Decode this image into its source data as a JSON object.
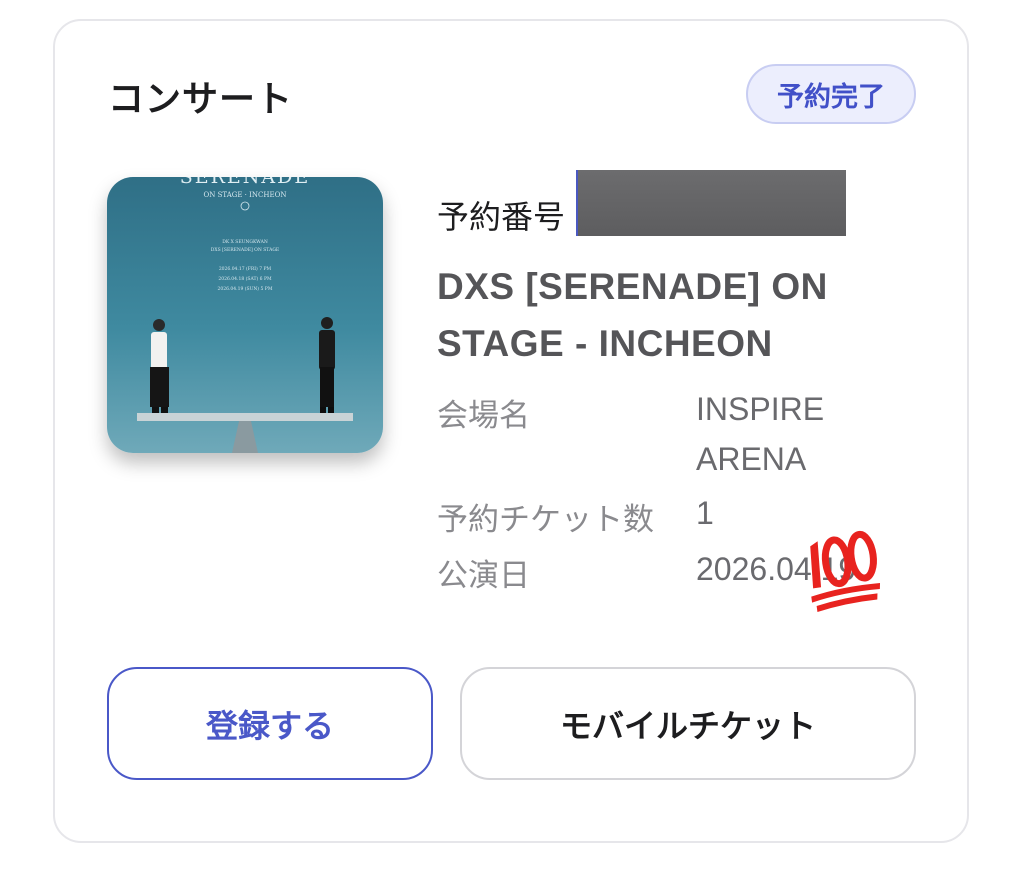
{
  "card": {
    "category": "コンサート",
    "status_badge": "予約完了"
  },
  "poster": {
    "title": "SERENADE",
    "subtitle": "ON STAGE · INCHEON",
    "artists": "DK X SEUNGKWAN",
    "event_line": "DXS [SERENADE] ON STAGE",
    "dates": [
      "2026.04.17 (FRI) 7 PM",
      "2026.04.18 (SAT) 6 PM",
      "2026.04.19 (SUN) 5 PM"
    ]
  },
  "reservation": {
    "number_label": "予約番号",
    "number_value_redacted": true
  },
  "event": {
    "title_line1": "DXS [SERENADE] ON",
    "title_line2": "STAGE - INCHEON"
  },
  "details": {
    "venue_label": "会場名",
    "venue_line1": "INSPIRE",
    "venue_line2": "ARENA",
    "tickets_label": "予約チケット数",
    "tickets_value": "1",
    "date_label": "公演日",
    "date_value": "2026.04.19"
  },
  "sticker": {
    "icon": "hundred-points-emoji",
    "color": "#e8231f"
  },
  "buttons": {
    "register_label": "登録する",
    "mobile_ticket_label": "モバイルチケット"
  },
  "colors": {
    "accent": "#4a58c8",
    "badge_bg": "#eceefd",
    "badge_text": "#4150c8",
    "card_border": "#e6e6ea"
  }
}
